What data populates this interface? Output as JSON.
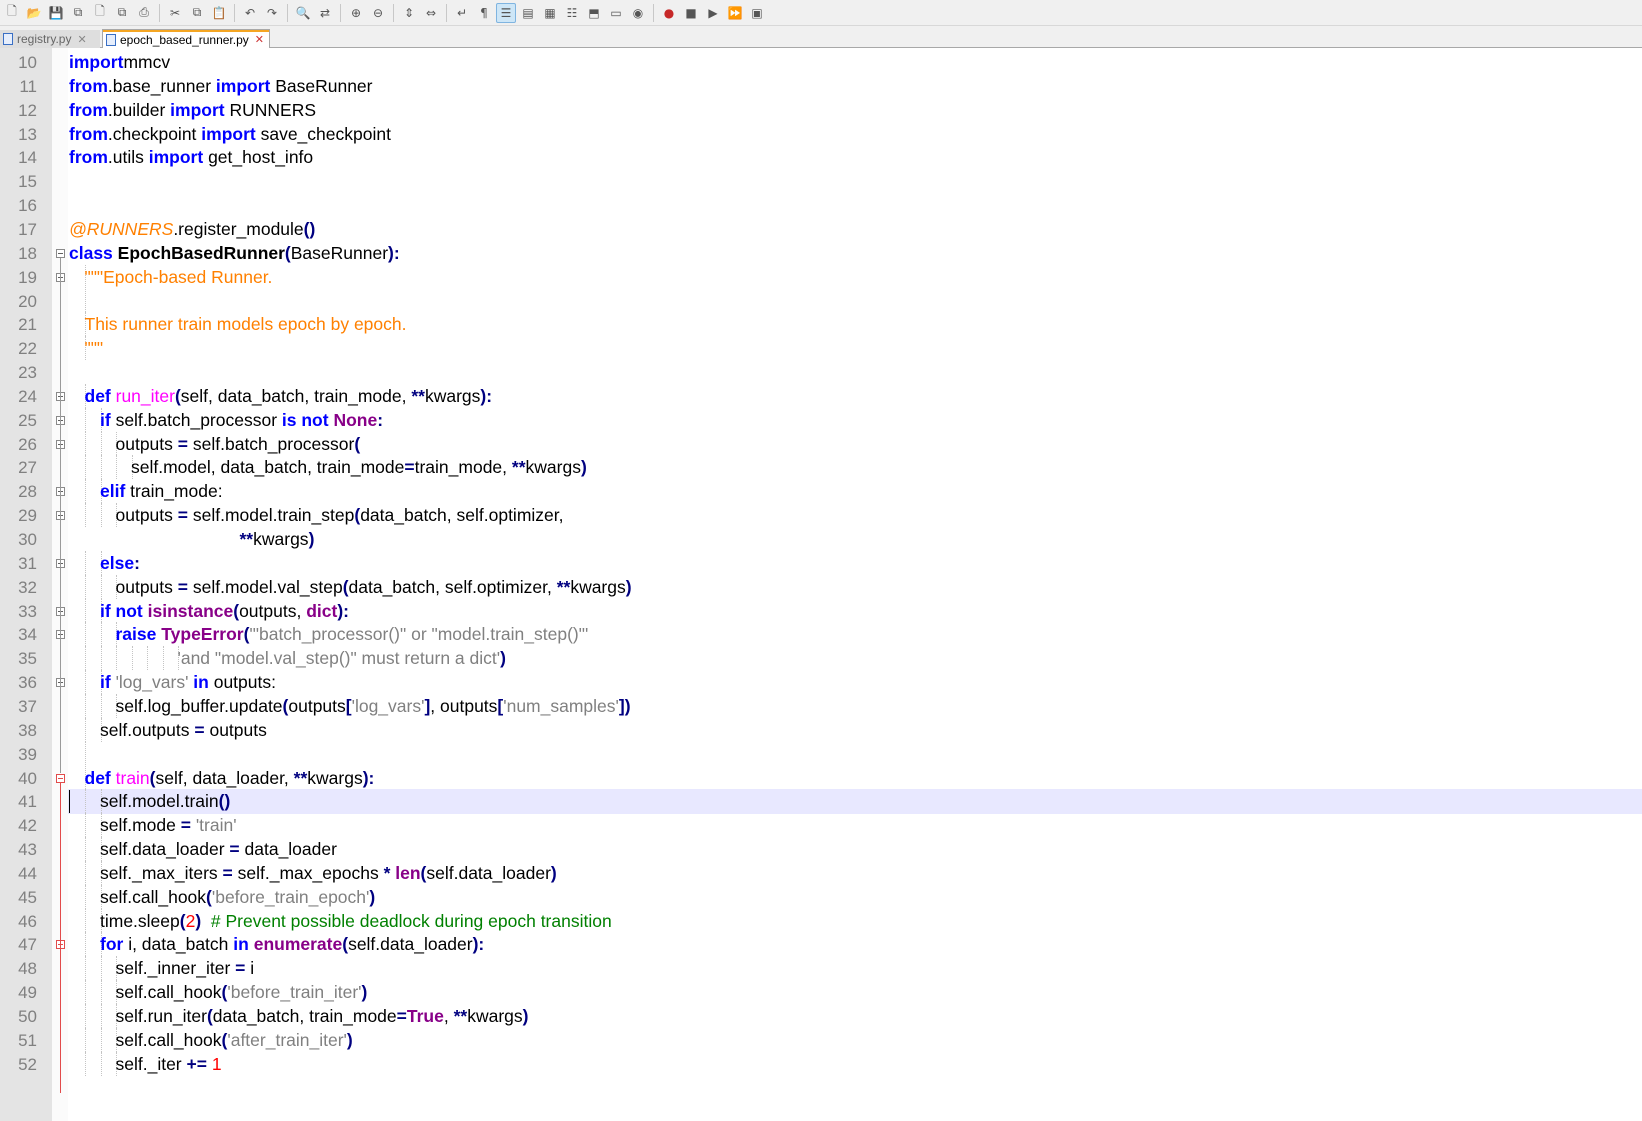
{
  "toolbar": {
    "buttons": [
      {
        "name": "new-file-icon",
        "glyph": "🗋"
      },
      {
        "name": "open-file-icon",
        "glyph": "📂"
      },
      {
        "name": "save-icon",
        "glyph": "💾"
      },
      {
        "name": "save-all-icon",
        "glyph": "⧉"
      },
      {
        "name": "close-icon",
        "glyph": "🗋"
      },
      {
        "name": "close-all-icon",
        "glyph": "⧉"
      },
      {
        "name": "print-icon",
        "glyph": "⎙"
      },
      {
        "sep": true
      },
      {
        "name": "cut-icon",
        "glyph": "✂"
      },
      {
        "name": "copy-icon",
        "glyph": "⧉"
      },
      {
        "name": "paste-icon",
        "glyph": "📋"
      },
      {
        "sep": true
      },
      {
        "name": "undo-icon",
        "glyph": "↶"
      },
      {
        "name": "redo-icon",
        "glyph": "↷"
      },
      {
        "sep": true
      },
      {
        "name": "find-icon",
        "glyph": "🔍"
      },
      {
        "name": "replace-icon",
        "glyph": "⇄"
      },
      {
        "sep": true
      },
      {
        "name": "zoom-in-icon",
        "glyph": "⊕"
      },
      {
        "name": "zoom-out-icon",
        "glyph": "⊖"
      },
      {
        "sep": true
      },
      {
        "name": "sync-vertical-icon",
        "glyph": "⇕"
      },
      {
        "name": "sync-horizontal-icon",
        "glyph": "⇔"
      },
      {
        "sep": true
      },
      {
        "name": "word-wrap-icon",
        "glyph": "↵"
      },
      {
        "name": "show-all-characters-icon",
        "glyph": "¶"
      },
      {
        "name": "indent-guide-icon",
        "glyph": "☰",
        "active": true
      },
      {
        "name": "user-defined-language-icon",
        "glyph": "▤"
      },
      {
        "name": "document-map-icon",
        "glyph": "▦"
      },
      {
        "name": "function-list-icon",
        "glyph": "☷"
      },
      {
        "name": "folder-as-workspace-icon",
        "glyph": "⬒"
      },
      {
        "name": "document-list-icon",
        "glyph": "▭"
      },
      {
        "name": "monitoring-icon",
        "glyph": "◉"
      },
      {
        "sep": true
      },
      {
        "name": "record-macro-icon",
        "glyph": "●",
        "color": "red"
      },
      {
        "name": "stop-recording-icon",
        "glyph": "■"
      },
      {
        "name": "playback-macro-icon",
        "glyph": "▶"
      },
      {
        "name": "run-macro-multiple-icon",
        "glyph": "⏩",
        "color": "blue"
      },
      {
        "name": "save-macro-icon",
        "glyph": "▣"
      }
    ]
  },
  "tabs": [
    {
      "label": "registry.py",
      "active": false
    },
    {
      "label": "epoch_based_runner.py",
      "active": true
    }
  ],
  "editor": {
    "current_line": 41,
    "lines": [
      {
        "n": "10",
        "indent": 0,
        "tokens": [
          [
            "kw",
            "import"
          ],
          [
            "",
            "mmcv"
          ]
        ]
      },
      {
        "n": "11",
        "indent": 0,
        "tokens": [
          [
            "kw",
            "from"
          ],
          [
            "",
            ".base_runner "
          ],
          [
            "kw",
            "import"
          ],
          [
            "",
            " BaseRunner"
          ]
        ]
      },
      {
        "n": "12",
        "indent": 0,
        "tokens": [
          [
            "kw",
            "from"
          ],
          [
            "",
            ".builder "
          ],
          [
            "kw",
            "import"
          ],
          [
            "",
            " RUNNERS"
          ]
        ]
      },
      {
        "n": "13",
        "indent": 0,
        "tokens": [
          [
            "kw",
            "from"
          ],
          [
            "",
            ".checkpoint "
          ],
          [
            "kw",
            "import"
          ],
          [
            "",
            " save_checkpoint"
          ]
        ]
      },
      {
        "n": "14",
        "indent": 0,
        "tokens": [
          [
            "kw",
            "from"
          ],
          [
            "",
            ".utils "
          ],
          [
            "kw",
            "import"
          ],
          [
            "",
            " get_host_info"
          ]
        ]
      },
      {
        "n": "15",
        "indent": 0,
        "tokens": []
      },
      {
        "n": "16",
        "indent": 0,
        "tokens": []
      },
      {
        "n": "17",
        "indent": 0,
        "tokens": [
          [
            "deco",
            "@RUNNERS"
          ],
          [
            "",
            ".register_module"
          ],
          [
            "op",
            "()"
          ]
        ]
      },
      {
        "n": "18",
        "indent": 0,
        "tokens": [
          [
            "kw",
            "class"
          ],
          [
            "",
            " "
          ],
          [
            "cls",
            "EpochBasedRunner"
          ],
          [
            "op",
            "("
          ],
          [
            "",
            "BaseRunner"
          ],
          [
            "op",
            "):"
          ]
        ]
      },
      {
        "n": "19",
        "indent": 1,
        "tokens": [
          [
            "doc",
            "\"\"\"Epoch-based Runner."
          ]
        ]
      },
      {
        "n": "20",
        "indent": 1,
        "tokens": []
      },
      {
        "n": "21",
        "indent": 1,
        "tokens": [
          [
            "doc",
            "This runner train models epoch by epoch."
          ]
        ]
      },
      {
        "n": "22",
        "indent": 1,
        "tokens": [
          [
            "doc",
            "\"\"\""
          ]
        ]
      },
      {
        "n": "23",
        "indent": 0,
        "tokens": []
      },
      {
        "n": "24",
        "indent": 1,
        "tokens": [
          [
            "kw",
            "def"
          ],
          [
            "",
            " "
          ],
          [
            "fn",
            "run_iter"
          ],
          [
            "op",
            "("
          ],
          [
            "",
            "self, data_batch, train_mode, "
          ],
          [
            "op",
            "**"
          ],
          [
            "",
            "kwargs"
          ],
          [
            "op",
            "):"
          ]
        ]
      },
      {
        "n": "25",
        "indent": 2,
        "tokens": [
          [
            "kw",
            "if"
          ],
          [
            "",
            " self.batch_processor "
          ],
          [
            "kw",
            "is not"
          ],
          [
            "",
            " "
          ],
          [
            "kw2",
            "None"
          ],
          [
            "op",
            ":"
          ]
        ]
      },
      {
        "n": "26",
        "indent": 3,
        "tokens": [
          [
            "",
            "outputs "
          ],
          [
            "op",
            "="
          ],
          [
            "",
            " self.batch_processor"
          ],
          [
            "op",
            "("
          ]
        ]
      },
      {
        "n": "27",
        "indent": 4,
        "tokens": [
          [
            "",
            "self.model, data_batch, train_mode"
          ],
          [
            "op",
            "="
          ],
          [
            "",
            "train_mode, "
          ],
          [
            "op",
            "**"
          ],
          [
            "",
            "kwargs"
          ],
          [
            "op",
            ")"
          ]
        ]
      },
      {
        "n": "28",
        "indent": 2,
        "tokens": [
          [
            "kw",
            "elif"
          ],
          [
            "",
            " train_mode:"
          ]
        ]
      },
      {
        "n": "29",
        "indent": 3,
        "tokens": [
          [
            "",
            "outputs "
          ],
          [
            "op",
            "="
          ],
          [
            "",
            " self.model.train_step"
          ],
          [
            "op",
            "("
          ],
          [
            "",
            "data_batch, self.optimizer,"
          ]
        ]
      },
      {
        "n": "30",
        "indent": 11,
        "tokens": [
          [
            "op",
            "**"
          ],
          [
            "",
            "kwargs"
          ],
          [
            "op",
            ")"
          ]
        ]
      },
      {
        "n": "31",
        "indent": 2,
        "tokens": [
          [
            "kw",
            "else"
          ],
          [
            "op",
            ":"
          ]
        ]
      },
      {
        "n": "32",
        "indent": 3,
        "tokens": [
          [
            "",
            "outputs "
          ],
          [
            "op",
            "="
          ],
          [
            "",
            " self.model.val_step"
          ],
          [
            "op",
            "("
          ],
          [
            "",
            "data_batch, self.optimizer, "
          ],
          [
            "op",
            "**"
          ],
          [
            "",
            "kwargs"
          ],
          [
            "op",
            ")"
          ]
        ]
      },
      {
        "n": "33",
        "indent": 2,
        "tokens": [
          [
            "kw",
            "if not"
          ],
          [
            "",
            " "
          ],
          [
            "kw2",
            "isinstance"
          ],
          [
            "op",
            "("
          ],
          [
            "",
            "outputs, "
          ],
          [
            "kw2",
            "dict"
          ],
          [
            "op",
            "):"
          ]
        ]
      },
      {
        "n": "34",
        "indent": 3,
        "tokens": [
          [
            "kw",
            "raise"
          ],
          [
            "",
            " "
          ],
          [
            "kw2",
            "TypeError"
          ],
          [
            "op",
            "("
          ],
          [
            "str",
            "'\"batch_processor()\" or \"model.train_step()\"'"
          ]
        ]
      },
      {
        "n": "35",
        "indent": 7,
        "tokens": [
          [
            "str",
            "'and \"model.val_step()\" must return a dict'"
          ],
          [
            "op",
            ")"
          ]
        ]
      },
      {
        "n": "36",
        "indent": 2,
        "tokens": [
          [
            "kw",
            "if"
          ],
          [
            "",
            " "
          ],
          [
            "str",
            "'log_vars'"
          ],
          [
            "",
            " "
          ],
          [
            "kw",
            "in"
          ],
          [
            "",
            " outputs:"
          ]
        ]
      },
      {
        "n": "37",
        "indent": 3,
        "tokens": [
          [
            "",
            "self.log_buffer.update"
          ],
          [
            "op",
            "("
          ],
          [
            "",
            "outputs"
          ],
          [
            "op",
            "["
          ],
          [
            "str",
            "'log_vars'"
          ],
          [
            "op",
            "]"
          ],
          [
            "",
            ", outputs"
          ],
          [
            "op",
            "["
          ],
          [
            "str",
            "'num_samples'"
          ],
          [
            "op",
            "])"
          ]
        ]
      },
      {
        "n": "38",
        "indent": 2,
        "tokens": [
          [
            "",
            "self.outputs "
          ],
          [
            "op",
            "="
          ],
          [
            "",
            " outputs"
          ]
        ]
      },
      {
        "n": "39",
        "indent": 1,
        "tokens": []
      },
      {
        "n": "40",
        "indent": 1,
        "tokens": [
          [
            "kw",
            "def"
          ],
          [
            "",
            " "
          ],
          [
            "fn",
            "train"
          ],
          [
            "op",
            "("
          ],
          [
            "",
            "self, data_loader, "
          ],
          [
            "op",
            "**"
          ],
          [
            "",
            "kwargs"
          ],
          [
            "op",
            "):"
          ]
        ]
      },
      {
        "n": "41",
        "indent": 2,
        "tokens": [
          [
            "",
            "self.model.train"
          ],
          [
            "op",
            "()"
          ]
        ]
      },
      {
        "n": "42",
        "indent": 2,
        "tokens": [
          [
            "",
            "self.mode "
          ],
          [
            "op",
            "="
          ],
          [
            "",
            " "
          ],
          [
            "str",
            "'train'"
          ]
        ]
      },
      {
        "n": "43",
        "indent": 2,
        "tokens": [
          [
            "",
            "self.data_loader "
          ],
          [
            "op",
            "="
          ],
          [
            "",
            " data_loader"
          ]
        ]
      },
      {
        "n": "44",
        "indent": 2,
        "tokens": [
          [
            "",
            "self._max_iters "
          ],
          [
            "op",
            "="
          ],
          [
            "",
            " self._max_epochs "
          ],
          [
            "op",
            "*"
          ],
          [
            "",
            " "
          ],
          [
            "kw2",
            "len"
          ],
          [
            "op",
            "("
          ],
          [
            "",
            "self.data_loader"
          ],
          [
            "op",
            ")"
          ]
        ]
      },
      {
        "n": "45",
        "indent": 2,
        "tokens": [
          [
            "",
            "self.call_hook"
          ],
          [
            "op",
            "("
          ],
          [
            "str",
            "'before_train_epoch'"
          ],
          [
            "op",
            ")"
          ]
        ]
      },
      {
        "n": "46",
        "indent": 2,
        "tokens": [
          [
            "",
            "time.sleep"
          ],
          [
            "op",
            "("
          ],
          [
            "num",
            "2"
          ],
          [
            "op",
            ")"
          ],
          [
            "",
            "  "
          ],
          [
            "cmt",
            "# Prevent possible deadlock during epoch transition"
          ]
        ]
      },
      {
        "n": "47",
        "indent": 2,
        "tokens": [
          [
            "kw",
            "for"
          ],
          [
            "",
            " i, data_batch "
          ],
          [
            "kw",
            "in"
          ],
          [
            "",
            " "
          ],
          [
            "kw2",
            "enumerate"
          ],
          [
            "op",
            "("
          ],
          [
            "",
            "self.data_loader"
          ],
          [
            "op",
            "):"
          ]
        ]
      },
      {
        "n": "48",
        "indent": 3,
        "tokens": [
          [
            "",
            "self._inner_iter "
          ],
          [
            "op",
            "="
          ],
          [
            "",
            " i"
          ]
        ]
      },
      {
        "n": "49",
        "indent": 3,
        "tokens": [
          [
            "",
            "self.call_hook"
          ],
          [
            "op",
            "("
          ],
          [
            "str",
            "'before_train_iter'"
          ],
          [
            "op",
            ")"
          ]
        ]
      },
      {
        "n": "50",
        "indent": 3,
        "tokens": [
          [
            "",
            "self.run_iter"
          ],
          [
            "op",
            "("
          ],
          [
            "",
            "data_batch, train_mode"
          ],
          [
            "op",
            "="
          ],
          [
            "kw2",
            "True"
          ],
          [
            "",
            ", "
          ],
          [
            "op",
            "**"
          ],
          [
            "",
            "kwargs"
          ],
          [
            "op",
            ")"
          ]
        ]
      },
      {
        "n": "51",
        "indent": 3,
        "tokens": [
          [
            "",
            "self.call_hook"
          ],
          [
            "op",
            "("
          ],
          [
            "str",
            "'after_train_iter'"
          ],
          [
            "op",
            ")"
          ]
        ]
      },
      {
        "n": "52",
        "indent": 3,
        "tokens": [
          [
            "",
            "self._iter "
          ],
          [
            "op",
            "+="
          ],
          [
            "",
            " "
          ],
          [
            "num",
            "1"
          ]
        ]
      }
    ],
    "folds": [
      {
        "line": "18",
        "type": "open"
      },
      {
        "line": "19",
        "type": "open"
      },
      {
        "line": "24",
        "type": "open"
      },
      {
        "line": "25",
        "type": "open"
      },
      {
        "line": "26",
        "type": "open"
      },
      {
        "line": "28",
        "type": "open"
      },
      {
        "line": "29",
        "type": "open"
      },
      {
        "line": "31",
        "type": "open"
      },
      {
        "line": "33",
        "type": "open"
      },
      {
        "line": "34",
        "type": "open"
      },
      {
        "line": "36",
        "type": "open"
      },
      {
        "line": "40",
        "type": "active"
      },
      {
        "line": "47",
        "type": "active"
      }
    ]
  }
}
